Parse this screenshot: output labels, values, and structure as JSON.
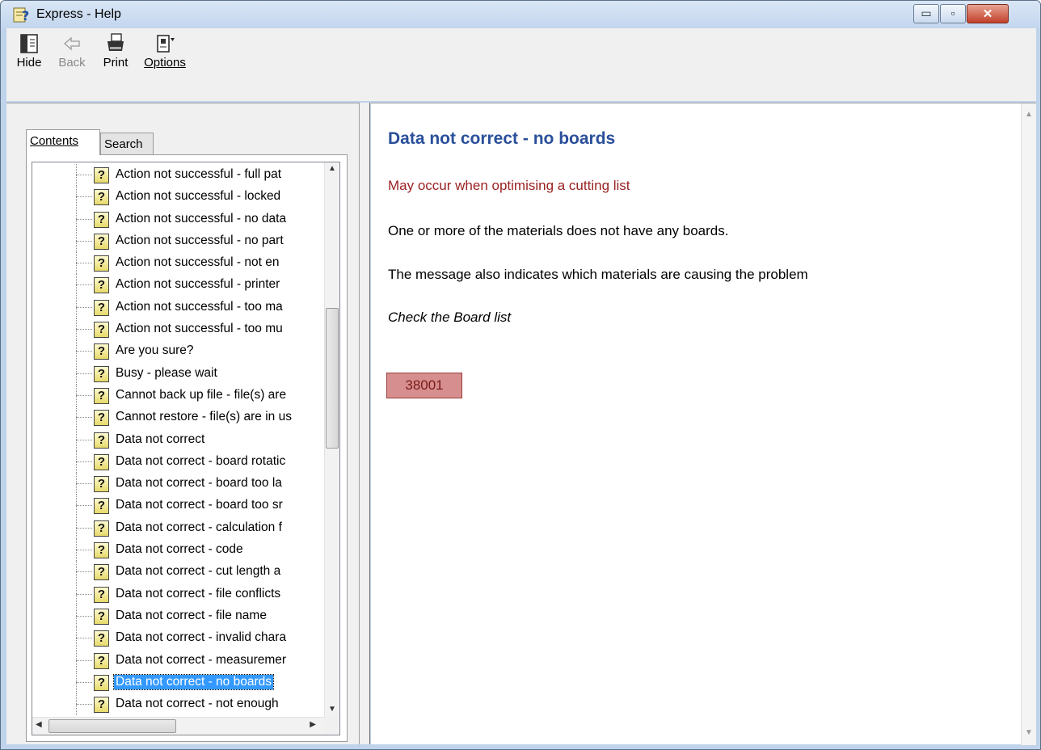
{
  "window": {
    "title": "Express - Help",
    "buttons": {
      "minimize": "▭",
      "maximize": "▫",
      "close": "✕"
    }
  },
  "toolbar": {
    "hide_label": "Hide",
    "back_label": "Back",
    "print_label": "Print",
    "options_label": "Options"
  },
  "tabs": {
    "contents": "Contents",
    "search": "Search"
  },
  "tree": {
    "items": [
      "Action not successful - full pat",
      "Action not successful - locked",
      "Action not successful - no data",
      "Action not successful - no part",
      "Action not successful - not en",
      "Action not successful - printer",
      "Action not successful - too ma",
      "Action not successful - too mu",
      "Are you sure?",
      "Busy - please wait",
      "Cannot back up file - file(s) are",
      "Cannot restore - file(s) are in us",
      "Data not correct",
      "Data not correct - board rotatic",
      "Data not correct - board too la",
      "Data not correct - board too sr",
      "Data not correct - calculation f",
      "Data not correct - code",
      "Data not correct - cut length a",
      "Data not correct - file conflicts",
      "Data not correct - file name",
      "Data not correct - invalid chara",
      "Data not correct - measuremer",
      "Data not correct - no boards",
      "Data not correct - not enough"
    ],
    "selected_index": 23
  },
  "content": {
    "heading": "Data not correct - no boards",
    "occurs": "May occur when optimising a cutting list",
    "para1": "One or more of the materials does not have any boards.",
    "para2": "The message also indicates which materials are causing the problem",
    "para3": "Check the Board list",
    "code": "38001"
  },
  "colors": {
    "heading": "#2a4f9a",
    "occurs": "#992222",
    "code_bg": "#d68e8e",
    "selection": "#3399ff"
  }
}
